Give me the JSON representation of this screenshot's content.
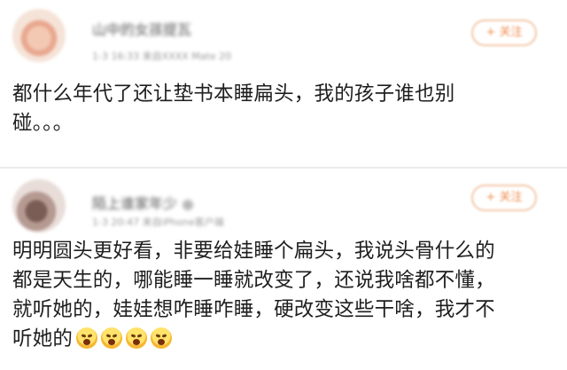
{
  "comments": [
    {
      "username": "山中的女孩提瓦",
      "meta": "1-3 16:33  来自XXXX Mate 20",
      "follow_label": "+ 关注",
      "text_line1": "都什么年代了还让垫书本睡扁头，我的孩子谁也别",
      "text_line2": "碰。。。"
    },
    {
      "username": "陌上谁家年少",
      "meta": "1-3 20:47  来自iPhone客户端",
      "follow_label": "+ 关注",
      "text_line1": "明明圆头更好看，非要给娃睡个扁头，我说头骨什么的",
      "text_line2": "都是天生的，哪能睡一睡就改变了，还说我啥都不懂，",
      "text_line3": "就听她的，娃娃想咋睡咋睡，硬改变这些干啥，我才不",
      "text_line4": "听她的",
      "emojis": [
        "angry-face-icon",
        "angry-face-icon",
        "angry-face-icon",
        "angry-face-icon"
      ]
    }
  ]
}
